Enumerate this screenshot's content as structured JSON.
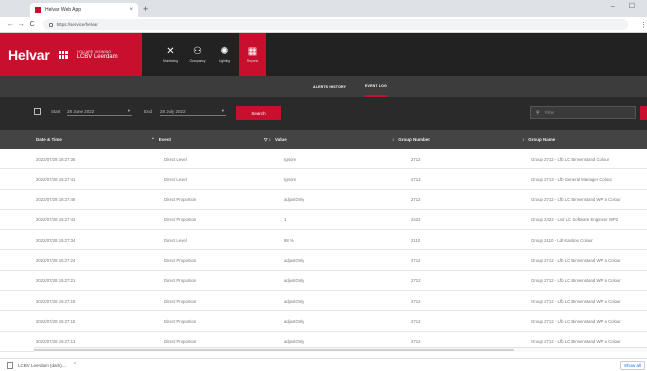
{
  "browser": {
    "tab_title": "Helvar Web App",
    "tab_close": "×",
    "new_tab": "+",
    "window_controls": "– ☐",
    "back": "←",
    "forward": "→",
    "reload": "C",
    "url": "https://service/helvar",
    "menu": "⋮"
  },
  "app": {
    "brand": "Helvar",
    "site_caption": "YOU ARE VIEWING",
    "site_name": "LCBV Leerdam",
    "accent_color": "#c8102e",
    "nav": [
      {
        "label": "Monitoring",
        "icon": "✕",
        "icon_name": "monitoring-icon",
        "active": false
      },
      {
        "label": "Occupancy",
        "icon": "⚇",
        "icon_name": "occupancy-icon",
        "active": false
      },
      {
        "label": "Lighting",
        "icon": "✺",
        "icon_name": "lighting-icon",
        "active": false
      },
      {
        "label": "Reports",
        "icon": "▦",
        "icon_name": "reports-icon",
        "active": true
      }
    ]
  },
  "subtabs": {
    "alerts": "ALERTS HISTORY",
    "events": "EVENT LOG"
  },
  "filters": {
    "start_label": "Start",
    "start_value": "28 June 2022",
    "end_label": "End",
    "end_value": "28 July 2022",
    "search_button": "Search",
    "search_placeholder": "Filter",
    "search_icon": "⚲"
  },
  "table": {
    "columns": [
      {
        "label": "Date & Time",
        "sort": ""
      },
      {
        "label": "Event",
        "sort": "⌃"
      },
      {
        "label": "Value",
        "sort": "▽ ↕"
      },
      {
        "label": "Group Number",
        "sort": "↕"
      },
      {
        "label": "Group Name",
        "sort": "↕"
      }
    ],
    "rows": [
      {
        "date": "2022/07/28 15:27:35",
        "event": "Direct Level",
        "value": "Ignore",
        "group": "2712",
        "name": "Group 2712 - Lfb LC Binnenstand Colour"
      },
      {
        "date": "2022/07/28 15:27:41",
        "event": "Direct Level",
        "value": "Ignore",
        "group": "2713",
        "name": "Group 2713 - Lfb General Manager Colour"
      },
      {
        "date": "2022/07/28 15:27:46",
        "event": "Direct Proportion",
        "value": "adjustOnly",
        "group": "2712",
        "name": "Group 2712 - Lfb LC Binnenstand WP a Colour"
      },
      {
        "date": "2022/07/28 15:27:42",
        "event": "Direct Proportion",
        "value": "1",
        "group": "2422",
        "name": "Group 2422 - Lsd LC Software Engineer WP2"
      },
      {
        "date": "2022/07/28 15:27:34",
        "event": "Direct Level",
        "value": "88 %",
        "group": "2110",
        "name": "Group 2110 - Ldt Kantine Colour"
      },
      {
        "date": "2022/07/28 15:27:24",
        "event": "Direct Proportion",
        "value": "adjustOnly",
        "group": "2712",
        "name": "Group 2712 - Lfb LC Binnenstand WP a Colour"
      },
      {
        "date": "2022/07/28 15:27:21",
        "event": "Direct Proportion",
        "value": "adjustOnly",
        "group": "2712",
        "name": "Group 2712 - Lfb LC Binnenstand WP a Colour"
      },
      {
        "date": "2022/07/28 15:27:18",
        "event": "Direct Proportion",
        "value": "adjustOnly",
        "group": "2712",
        "name": "Group 2712 - Lfb LC Binnenstand WP a Colour"
      },
      {
        "date": "2022/07/28 15:27:15",
        "event": "Direct Proportion",
        "value": "adjustOnly",
        "group": "2712",
        "name": "Group 2712 - Lfb LC Binnenstand WP a Colour"
      },
      {
        "date": "2022/07/28 15:27:13",
        "event": "Direct Proportion",
        "value": "adjustOnly",
        "group": "2712",
        "name": "Group 2712 - Lfb LC Binnenstand WP a Colour"
      }
    ]
  },
  "statusbar": {
    "download_name": "LCBV Leerdam (dark)....",
    "download_arrow": "⌃",
    "show_all": "Show all"
  }
}
